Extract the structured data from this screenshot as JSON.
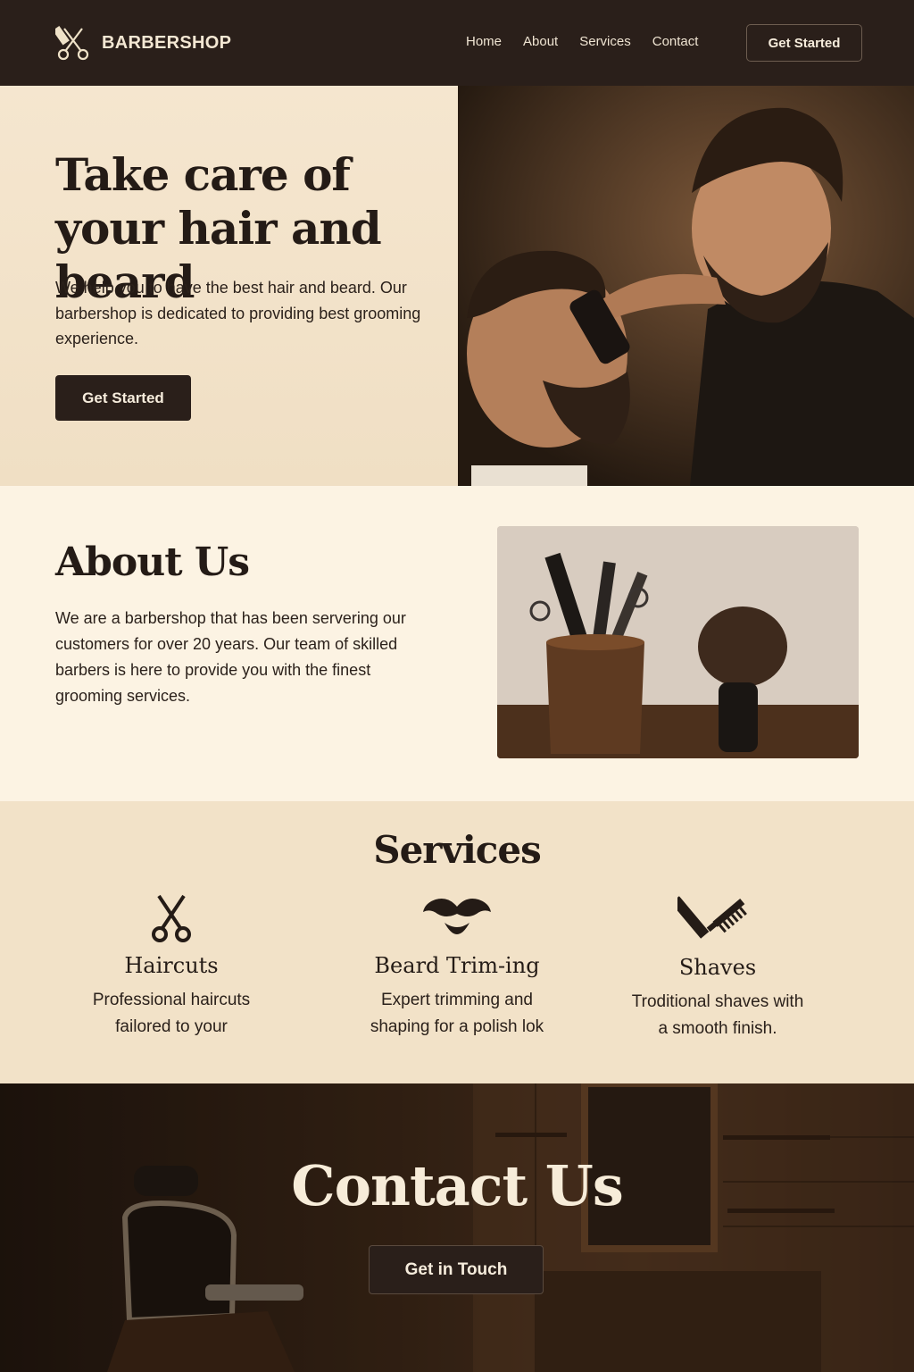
{
  "nav": {
    "brand": "BARBERSHOP",
    "links": [
      "Home",
      "About",
      "Services",
      "Contact"
    ],
    "cta": "Get Started"
  },
  "hero": {
    "title": "Take care of your hair and beard",
    "description": "We help you to have the best hair and beard. Our barbershop is dedicated to providing best grooming experience.",
    "button": "Get Started",
    "image_icon": "barber-trimming-beard-photo"
  },
  "about": {
    "title": "About Us",
    "description": "We are a barbershop that has been servering our customers for over 20 years. Our team of skilled barbers is here to provide you with the finest grooming services.",
    "image_icon": "barber-tools-cup-and-shaving-brush-photo"
  },
  "services": {
    "title": "Services",
    "items": [
      {
        "icon": "scissors-icon",
        "name": "Haircuts",
        "description": "Professional haircuts\nfailored to your"
      },
      {
        "icon": "mustache-icon",
        "name": "Beard Trim-ing",
        "description": "Expert trimming and\nshaping for a polish lok"
      },
      {
        "icon": "razor-comb-icon",
        "name": "Shaves",
        "description": "Troditional shaves with\na smooth finish."
      }
    ]
  },
  "contact": {
    "title": "Contact Us",
    "button": "Get in Touch",
    "image_icon": "barbershop-interior-chair-photo"
  },
  "colors": {
    "dark": "#2a1f1a",
    "cream": "#fcf3e3",
    "beige": "#f2e2c8",
    "light_text": "#f6ecdc"
  }
}
